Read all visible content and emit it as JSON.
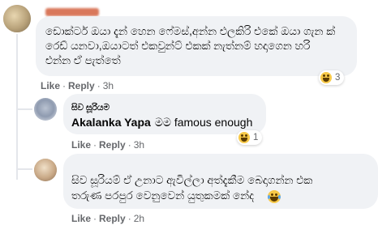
{
  "comment_main": {
    "line1": "ඩොක්ටර් ඔයා දැන් හෙන ෆේමස්,අන්න එලකිරි එකේ ඔයා ගැන ක්",
    "line2": "රෙඩ් යනවා,ඔයාටත් එකවුන්ට් එකක් නැත්නම් හදාගෙන හරි",
    "line3": "එන්න ඒ පැත්තේ",
    "like": "Like",
    "reply": "Reply",
    "time": "3h",
    "reaction_count": "3",
    "reaction_icon": "haha-emoji-icon"
  },
  "reply_1": {
    "author": "සිව සූරියම",
    "mention": "Akalanka Yapa",
    "text": "මම famous enough",
    "like": "Like",
    "reply": "Reply",
    "time": "3h",
    "reaction_count": "1",
    "reaction_icon": "haha-emoji-icon"
  },
  "reply_2": {
    "line1": "සිව සූරියම් ඒ උනාට ඇවිල්ලා අත්දැකීම බෙදාගන්න එක",
    "line2": "තරුණ පරපුර වෙනුවෙන් යුතුකමක් නේද",
    "like": "Like",
    "reply": "Reply",
    "time": "2h",
    "inline_emoji": "laughing-tears-emoji-icon"
  },
  "separator": "·",
  "colors": {
    "bubble": "#f0f2f5",
    "meta_text": "#65676b",
    "emoji": "#f7c948",
    "redaction": "#d9785b"
  }
}
